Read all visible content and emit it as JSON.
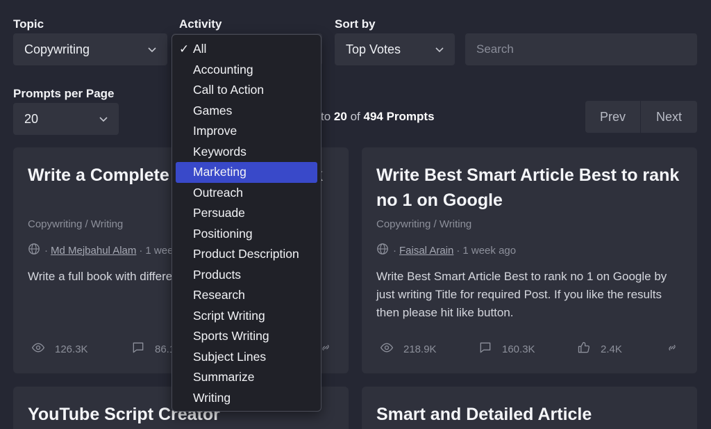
{
  "filters": {
    "topic_label": "Topic",
    "topic_value": "Copywriting",
    "activity_label": "Activity",
    "sort_label": "Sort by",
    "sort_value": "Top Votes",
    "search_placeholder": "Search",
    "per_page_label": "Prompts per Page",
    "per_page_value": "20"
  },
  "showing": {
    "prefix": "to",
    "to": "20",
    "of": "of",
    "total": "494 Prompts"
  },
  "pager": {
    "prev": "Prev",
    "next": "Next"
  },
  "dropdown": {
    "checkmark": "✓",
    "options": [
      "All",
      "Accounting",
      "Call to Action",
      "Games",
      "Improve",
      "Keywords",
      "Marketing",
      "Outreach",
      "Persuade",
      "Positioning",
      "Product Description",
      "Products",
      "Research",
      "Script Writing",
      "Sports Writing",
      "Subject Lines",
      "Summarize",
      "Writing"
    ],
    "checked": "All",
    "highlighted": "Marketing"
  },
  "cards": [
    {
      "title": "Write a Complete Book in One Click",
      "category": "Copywriting / Writing",
      "author": "Md Mejbahul Alam",
      "time": "1 week ago",
      "description": "Write a full book with different chapters",
      "views": "126.3K",
      "comments": "86.1K",
      "likes": "",
      "separator": "·"
    },
    {
      "title": "Write Best Smart Article Best to rank no 1 on Google",
      "category": "Copywriting / Writing",
      "author": "Faisal Arain",
      "time": "1 week ago",
      "description": "Write Best Smart Article Best to rank no 1 on Google by just writing Title for required Post. If you like the results then please hit like button.",
      "views": "218.9K",
      "comments": "160.3K",
      "likes": "2.4K",
      "separator": "·"
    },
    {
      "title": "YouTube Script Creator"
    },
    {
      "title": "Smart and Detailed Article"
    }
  ],
  "colors": {
    "background": "#252733",
    "card": "#2f313c",
    "accent": "#3949c9"
  }
}
